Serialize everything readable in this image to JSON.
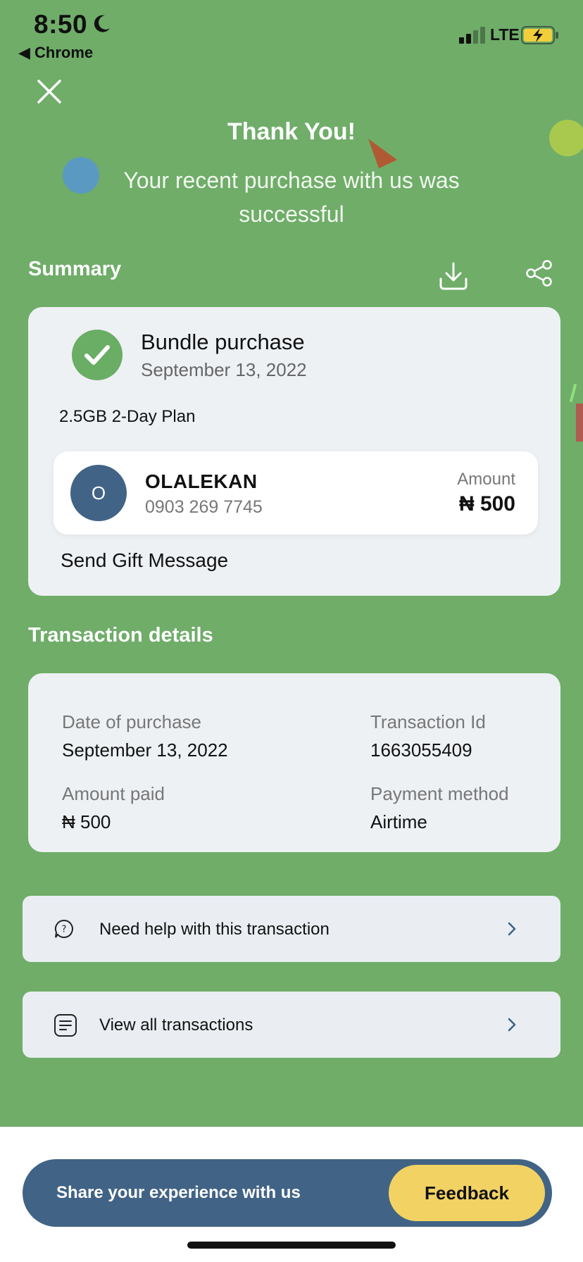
{
  "status_bar": {
    "time": "8:50",
    "back_app": "◀ Chrome",
    "network": "LTE"
  },
  "header": {
    "title": "Thank You!",
    "subtitle": "Your recent purchase with us was successful"
  },
  "summary": {
    "title": "Summary",
    "purchase_title": "Bundle purchase",
    "purchase_date": "September 13, 2022",
    "plan": "2.5GB 2-Day Plan",
    "recipient": {
      "initial": "O",
      "name": "OLALEKAN",
      "phone": "0903 269 7745",
      "amount_label": "Amount",
      "amount_value": "₦ 500"
    },
    "gift_message": "Send Gift Message"
  },
  "transaction_details": {
    "title": "Transaction details",
    "date_label": "Date of purchase",
    "date_value": "September 13, 2022",
    "id_label": "Transaction Id",
    "id_value": "1663055409",
    "amount_label": "Amount paid",
    "amount_value": "₦ 500",
    "method_label": "Payment method",
    "method_value": "Airtime"
  },
  "actions": {
    "help": "Need help with this transaction",
    "view_all": "View all transactions"
  },
  "feedback": {
    "prompt": "Share your experience with us",
    "button": "Feedback"
  },
  "colors": {
    "background_green": "#6fad69",
    "card": "#eef1f4",
    "navy": "#416385",
    "yellow": "#f2d263"
  },
  "icons": [
    "moon-icon",
    "signal-icon",
    "battery-charging-icon",
    "close-icon",
    "download-icon",
    "share-icon",
    "check-icon",
    "help-chat-icon",
    "transactions-list-icon",
    "chevron-right-icon"
  ]
}
